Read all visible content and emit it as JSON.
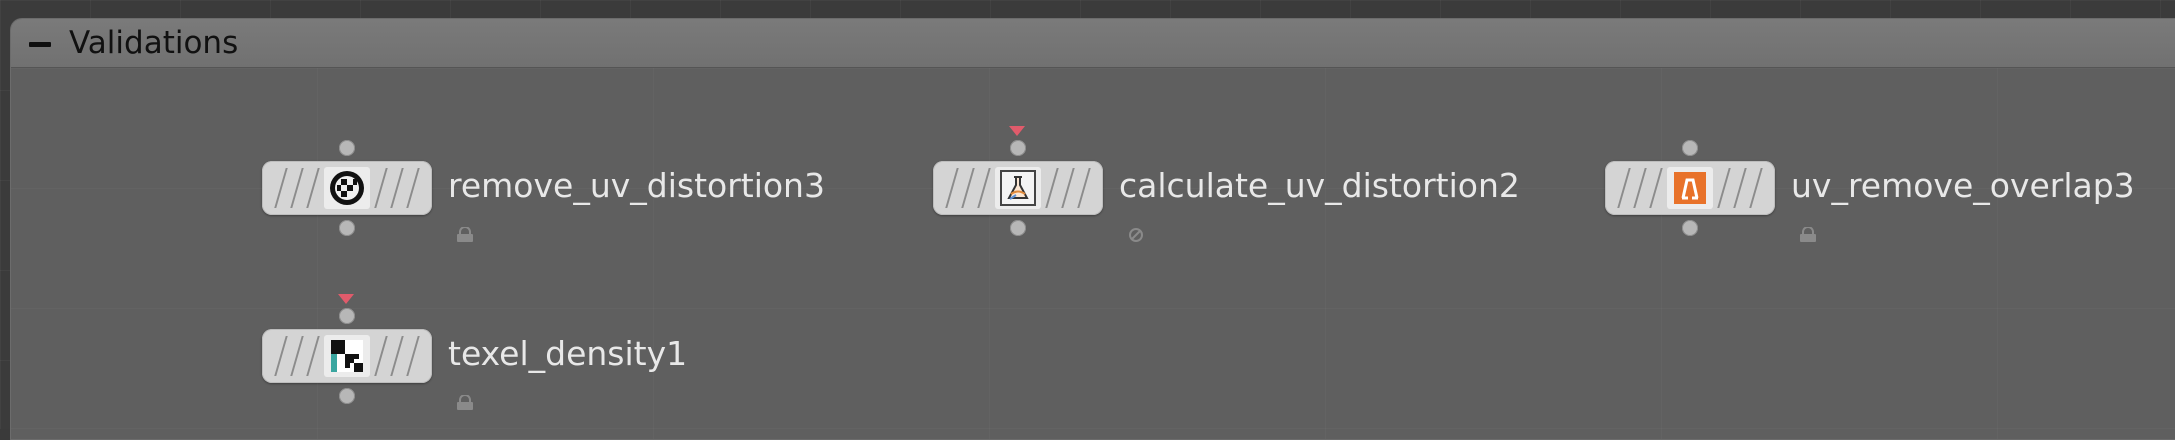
{
  "network_box": {
    "title": "Validations",
    "collapse_icon": "minus-icon"
  },
  "nodes": [
    {
      "name": "remove_uv_distortion3",
      "icon": "uv-checker-ball-icon",
      "flag": false,
      "badge": "lock-icon"
    },
    {
      "name": "calculate_uv_distortion2",
      "icon": "uv-distortion-flask-icon",
      "flag": true,
      "badge": "bypass-icon"
    },
    {
      "name": "uv_remove_overlap3",
      "icon": "uv-overlap-orange-icon",
      "flag": false,
      "badge": "lock-icon"
    },
    {
      "name": "texel_density1",
      "icon": "texel-checker-icon",
      "flag": true,
      "badge": "lock-icon"
    }
  ],
  "colors": {
    "flag": "#e05b6b",
    "overlap_icon": "#e8722a",
    "node_body": "#d4d4d4"
  }
}
